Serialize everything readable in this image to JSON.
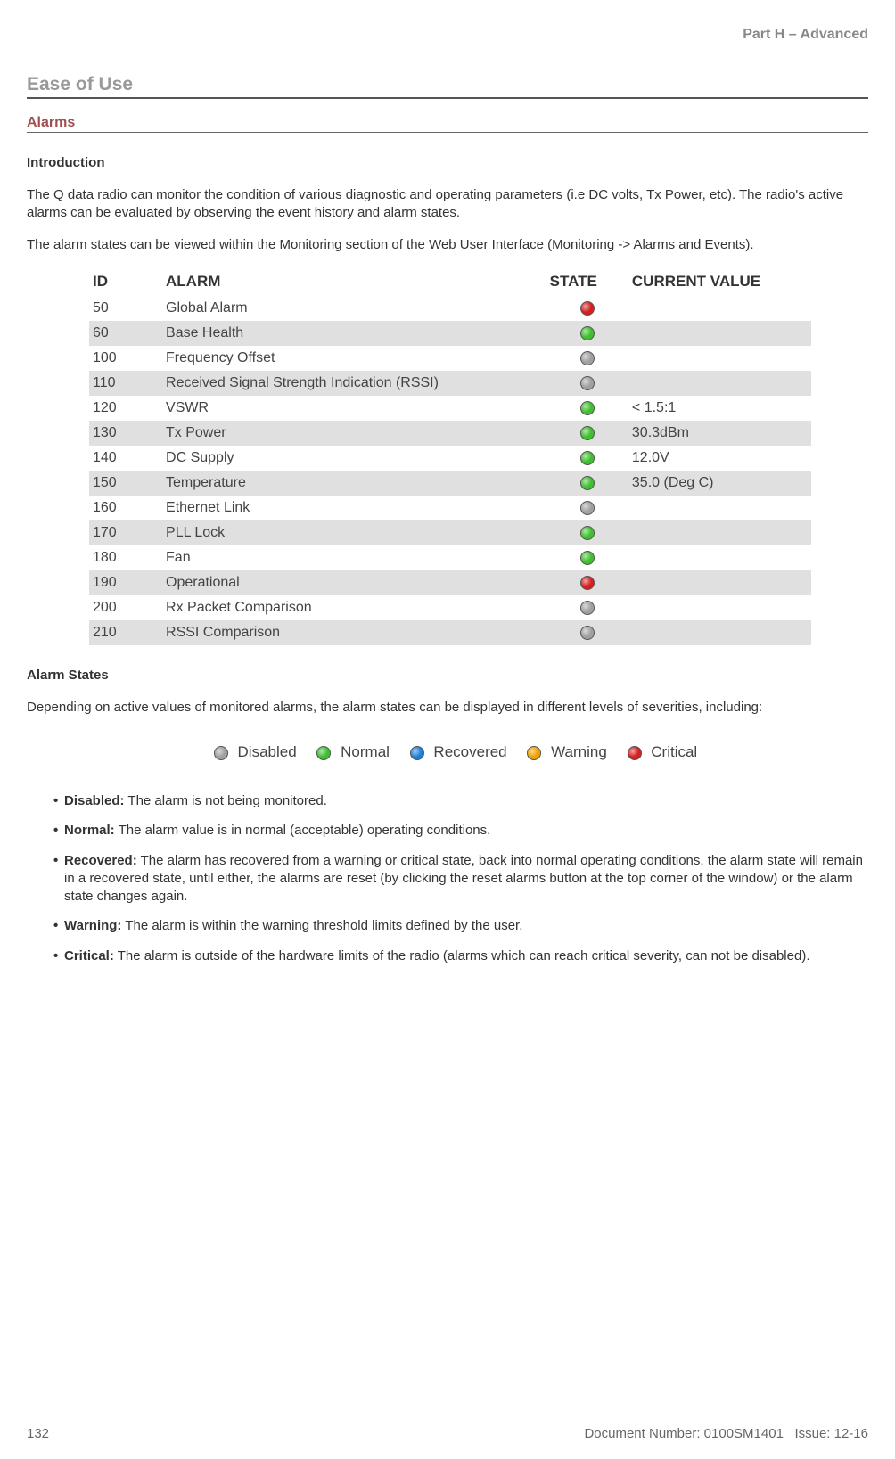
{
  "header": {
    "partLabel": "Part H – Advanced"
  },
  "sections": {
    "easeOfUse": "Ease of Use",
    "alarms": "Alarms",
    "introduction": "Introduction",
    "alarmStates": "Alarm States"
  },
  "paragraphs": {
    "intro1": "The Q data radio can monitor the condition of various diagnostic and operating parameters (i.e DC volts, Tx Power, etc). The radio's active alarms can be evaluated by observing the event history and alarm states.",
    "intro2": "The alarm states can be viewed within the Monitoring section of the Web User Interface (Monitoring -> Alarms and Events).",
    "statesIntro": "Depending on active values of monitored alarms, the alarm states can be displayed in different levels of severities, including:"
  },
  "table": {
    "headers": {
      "id": "ID",
      "alarm": "ALARM",
      "state": "STATE",
      "value": "CURRENT VALUE"
    },
    "rows": [
      {
        "id": "50",
        "alarm": "Global Alarm",
        "state": "red",
        "value": ""
      },
      {
        "id": "60",
        "alarm": "Base Health",
        "state": "green",
        "value": ""
      },
      {
        "id": "100",
        "alarm": "Frequency Offset",
        "state": "grey",
        "value": ""
      },
      {
        "id": "110",
        "alarm": "Received Signal Strength Indication (RSSI)",
        "state": "grey",
        "value": ""
      },
      {
        "id": "120",
        "alarm": "VSWR",
        "state": "green",
        "value": "< 1.5:1"
      },
      {
        "id": "130",
        "alarm": "Tx Power",
        "state": "green",
        "value": "30.3dBm"
      },
      {
        "id": "140",
        "alarm": "DC Supply",
        "state": "green",
        "value": "12.0V"
      },
      {
        "id": "150",
        "alarm": "Temperature",
        "state": "green",
        "value": "35.0 (Deg C)"
      },
      {
        "id": "160",
        "alarm": "Ethernet Link",
        "state": "grey",
        "value": ""
      },
      {
        "id": "170",
        "alarm": "PLL Lock",
        "state": "green",
        "value": ""
      },
      {
        "id": "180",
        "alarm": "Fan",
        "state": "green",
        "value": ""
      },
      {
        "id": "190",
        "alarm": "Operational",
        "state": "red",
        "value": ""
      },
      {
        "id": "200",
        "alarm": "Rx Packet Comparison",
        "state": "grey",
        "value": ""
      },
      {
        "id": "210",
        "alarm": "RSSI Comparison",
        "state": "grey",
        "value": ""
      }
    ]
  },
  "legend": {
    "disabled": "Disabled",
    "normal": "Normal",
    "recovered": "Recovered",
    "warning": "Warning",
    "critical": "Critical"
  },
  "definitions": [
    {
      "term": "Disabled:",
      "desc": " The alarm is not being monitored."
    },
    {
      "term": "Normal:",
      "desc": " The alarm value is in normal (acceptable) operating conditions."
    },
    {
      "term": "Recovered:",
      "desc": " The alarm has recovered from a warning or critical state, back into normal operating conditions, the alarm state will remain in a recovered state, until either, the alarms are reset (by clicking the reset alarms button at the top corner of the window) or the alarm state changes again."
    },
    {
      "term": "Warning:",
      "desc": " The alarm is within the warning threshold limits defined by the user."
    },
    {
      "term": "Critical:",
      "desc": " The alarm is outside of the hardware limits of the radio (alarms which can reach critical severity, can not be disabled)."
    }
  ],
  "colors": {
    "red": "#d62020",
    "green": "#3fbf2f",
    "grey": "#a0a0a0",
    "blue": "#1f7fd6",
    "orange": "#f0a000"
  },
  "footer": {
    "page": "132",
    "docnum": "Document Number: 0100SM1401",
    "issue": "Issue: 12-16"
  }
}
